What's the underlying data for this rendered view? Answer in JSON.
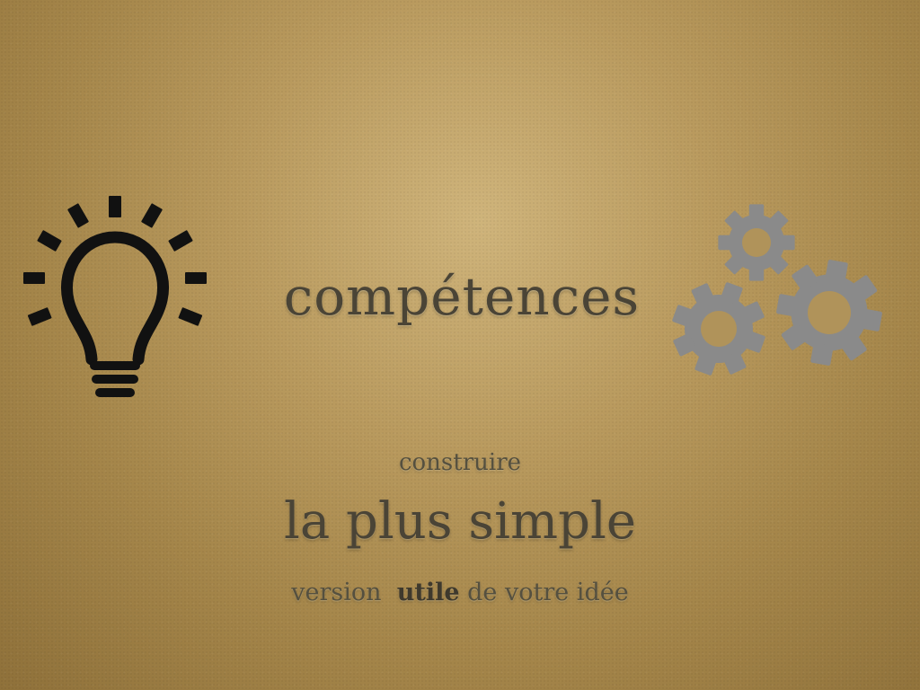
{
  "slide": {
    "title": "compétences",
    "line1": "construire",
    "line2": "la plus simple",
    "line3_before": "version",
    "line3_emphasis": "utile",
    "line3_after": "de votre idée"
  },
  "icons": {
    "left": "lightbulb-icon",
    "right": "gears-icon"
  },
  "colors": {
    "background": "#b99a5e",
    "text": "#4a4436",
    "bulb": "#111111",
    "gears": "#8a8a8a"
  }
}
